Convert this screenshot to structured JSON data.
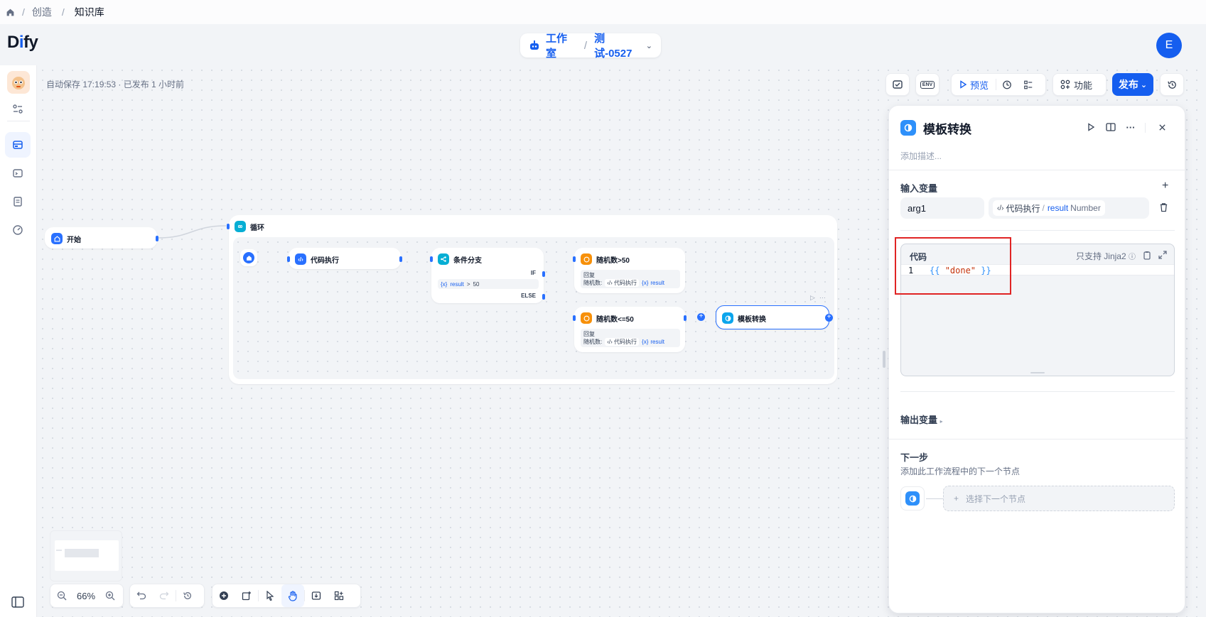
{
  "breadcrumb": {
    "home_icon": "home-icon",
    "items": [
      "创造",
      "知识库"
    ],
    "separator": "/"
  },
  "header": {
    "logo_prefix": "D",
    "logo_mid": "i",
    "logo_rest": "fy",
    "workspace": "工作室",
    "separator": "/",
    "app_name": "测试-0527",
    "avatar": "E"
  },
  "canvas": {
    "autosave": "自动保存 17:19:53 · 已发布 1 小时前",
    "toolbar": {
      "env_label": "ENV",
      "preview": "预览",
      "features": "功能",
      "publish": "发布"
    }
  },
  "nodes": {
    "start": "开始",
    "loop": "循环",
    "code": "代码执行",
    "if_else": "条件分支",
    "if_label": "IF",
    "else_label": "ELSE",
    "condition_var": "result",
    "condition_op": ">",
    "condition_val": "50",
    "reply_gt": "随机数>50",
    "reply_le": "随机数<=50",
    "reply_label": "回复",
    "reply_prefix": "随机数:",
    "reply_src": "代码执行",
    "reply_var": "result",
    "template": "模板转换"
  },
  "panel": {
    "title": "模板转换",
    "description_placeholder": "添加描述...",
    "input_vars_title": "输入变量",
    "var_name": "arg1",
    "var_source": "代码执行",
    "var_slash": "/",
    "var_field": "result",
    "var_type": "Number",
    "code_title": "代码",
    "jinja_note": "只支持 Jinja2",
    "code_line_no": "1",
    "code_open": "{{ ",
    "code_string": "\"done\"",
    "code_close": " }}",
    "output_vars_title": "输出变量",
    "next_step_title": "下一步",
    "next_step_desc": "添加此工作流程中的下一个节点",
    "select_next": "选择下一个节点"
  },
  "controls": {
    "zoom": "66%"
  },
  "colors": {
    "accent": "#155eef",
    "highlight_box": "#e02424"
  }
}
